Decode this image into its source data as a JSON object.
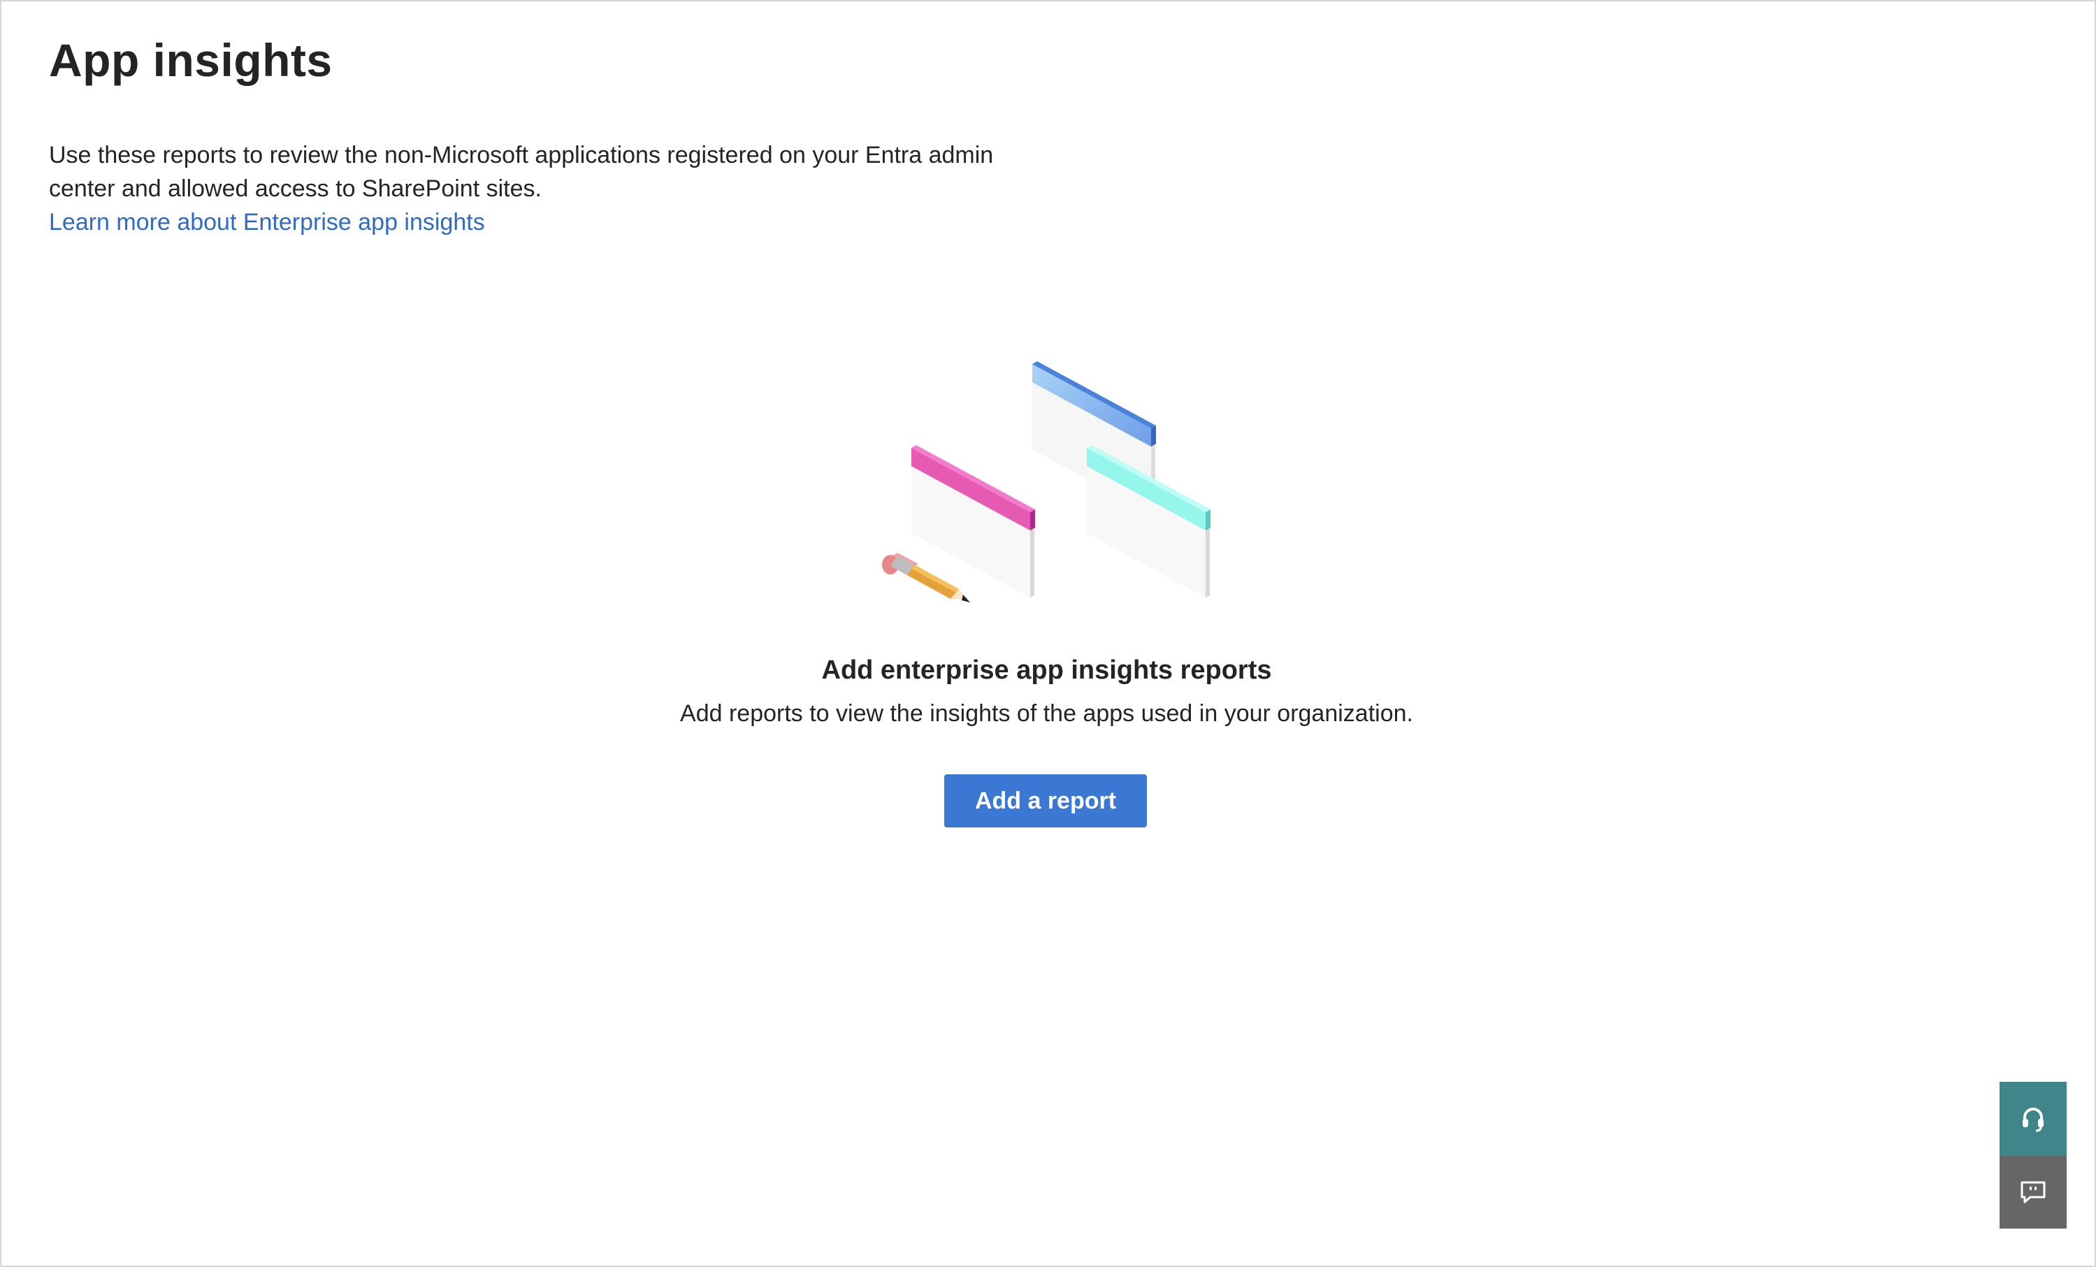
{
  "page": {
    "title": "App insights",
    "description": "Use these reports to review the non-Microsoft applications registered on your Entra admin center and allowed access to SharePoint sites.",
    "learn_more_link": "Learn more about Enterprise app insights"
  },
  "empty_state": {
    "title": "Add enterprise app insights reports",
    "subtitle": "Add reports to view the insights of the apps used in your organization.",
    "button_label": "Add a report"
  },
  "side_tools": {
    "support_icon": "headset-icon",
    "feedback_icon": "chat-feedback-icon"
  },
  "colors": {
    "accent": "#3b78d4",
    "link": "#2f6bc4",
    "support_bg": "#3f8589",
    "feedback_bg": "#666666",
    "window_pink": "#e44fb0",
    "window_blue": "#6fa3e6",
    "window_cyan": "#8ff5ec"
  }
}
